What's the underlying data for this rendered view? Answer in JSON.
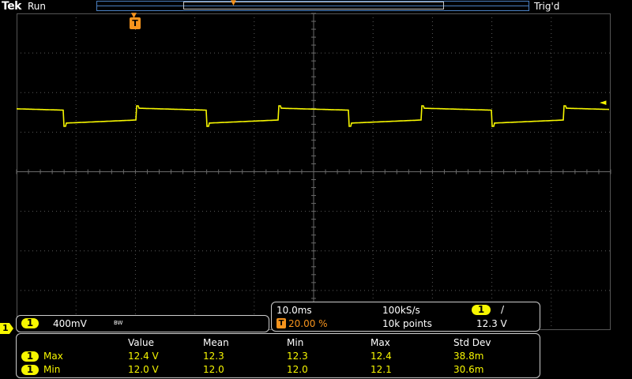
{
  "header": {
    "brand": "Tek",
    "run_state": "Run",
    "trigger_status": "Trig'd"
  },
  "markers": {
    "trigger_position_label": "T",
    "trigger_level_arrow": "◄",
    "channel_reference_label": "1"
  },
  "channel1": {
    "badge": "1",
    "scale": "400mV",
    "bandwidth_limit": "BW",
    "color": "#f7f700"
  },
  "horizontal": {
    "time_per_div": "10.0ms",
    "sample_rate": "100kS/s",
    "trigger_badge": "T",
    "trigger_position": "20.00 %",
    "record_length": "10k points",
    "trigger_source_badge": "1",
    "trigger_slope": "/",
    "trigger_level": "12.3 V"
  },
  "measurements": {
    "headers": [
      "Value",
      "Mean",
      "Min",
      "Max",
      "Std Dev"
    ],
    "rows": [
      {
        "channel": "1",
        "name": "Max",
        "value": "12.4 V",
        "mean": "12.3",
        "min": "12.3",
        "max": "12.4",
        "std_dev": "38.8m"
      },
      {
        "channel": "1",
        "name": "Min",
        "value": "12.0 V",
        "mean": "12.0",
        "min": "12.0",
        "max": "12.1",
        "std_dev": "30.6m"
      }
    ]
  },
  "colors": {
    "trace": "#f7f700",
    "trigger_marker": "#f7941d",
    "record_bar": "#4a7fc0"
  }
}
